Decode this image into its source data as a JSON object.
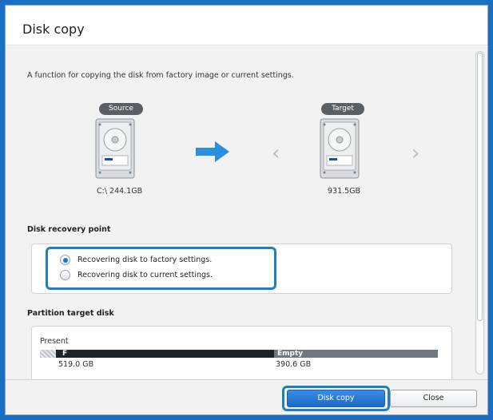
{
  "window": {
    "title": "Disk copy"
  },
  "description": "A function for copying the disk from factory image or current settings.",
  "source": {
    "badge": "Source",
    "label": "C:\\ 244.1GB"
  },
  "target": {
    "badge": "Target",
    "label": "931.5GB"
  },
  "recovery": {
    "title": "Disk recovery point",
    "options": [
      {
        "label": "Recovering disk to factory settings.",
        "selected": true
      },
      {
        "label": "Recovering disk to current settings.",
        "selected": false
      }
    ]
  },
  "partition": {
    "title": "Partition target disk",
    "present_label": "Present",
    "segments": [
      {
        "name": "F",
        "size": "519.0 GB"
      },
      {
        "name": "Empty",
        "size": "390.6 GB"
      }
    ]
  },
  "buttons": {
    "disk_copy": "Disk copy",
    "close": "Close"
  },
  "colors": {
    "accent": "#1e7fc5",
    "primary_button": "#1b69c7",
    "dark_bar": "#1f2328",
    "empty_bar": "#6f7780"
  }
}
